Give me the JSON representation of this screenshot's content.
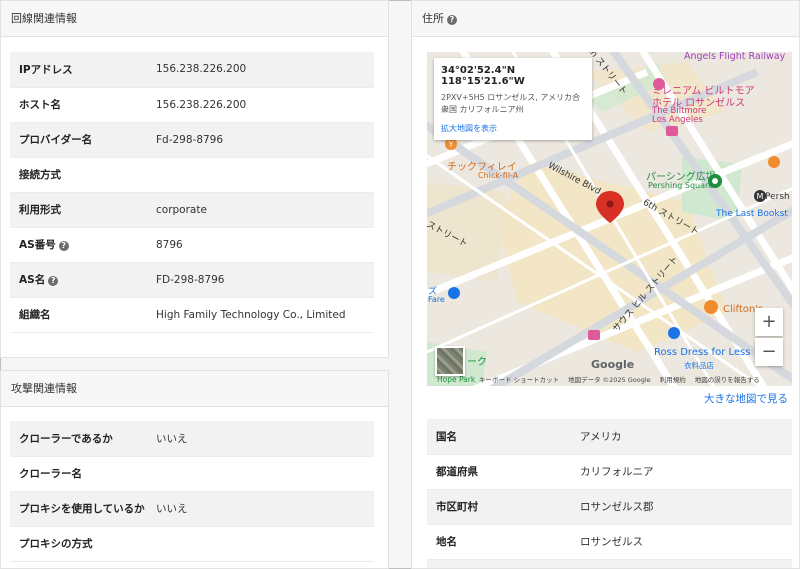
{
  "line_panel": {
    "title": "回線関連情報",
    "rows": [
      {
        "label": "IPアドレス",
        "value": "156.238.226.200",
        "help": false
      },
      {
        "label": "ホスト名",
        "value": "156.238.226.200",
        "help": false
      },
      {
        "label": "プロバイダー名",
        "value": "Fd-298-8796",
        "help": false
      },
      {
        "label": "接続方式",
        "value": "",
        "help": false
      },
      {
        "label": "利用形式",
        "value": "corporate",
        "help": false
      },
      {
        "label": "AS番号",
        "value": "8796",
        "help": true
      },
      {
        "label": "AS名",
        "value": "FD-298-8796",
        "help": true
      },
      {
        "label": "組織名",
        "value": "High Family Technology Co., Limited",
        "help": false
      }
    ]
  },
  "attack_panel": {
    "title": "攻撃関連情報",
    "rows": [
      {
        "label": "クローラーであるか",
        "value": "いいえ"
      },
      {
        "label": "クローラー名",
        "value": ""
      },
      {
        "label": "プロキシを使用しているか",
        "value": "いいえ"
      },
      {
        "label": "プロキシの方式",
        "value": ""
      }
    ]
  },
  "address_panel": {
    "title": "住所",
    "map": {
      "coords": "34°02'52.4\"N 118°15'21.6\"W",
      "address_line1": "2PXV+5H5 ロサンゼルス, アメリカ合",
      "address_line2": "衆国 カリフォルニア州",
      "larger_map_link": "拡大地図を表示",
      "zoom_in": "+",
      "zoom_out": "−",
      "google_logo": "Google",
      "attribution": [
        "キーボード ショートカット",
        "地図データ ©2025 Google",
        "利用規約",
        "地図の誤りを報告する"
      ],
      "labels": {
        "angels_flight": "Angels Flight Railway",
        "millennium_1": "ミレニアム ビルトモア",
        "millennium_2": "ホテル ロサンゼルス",
        "biltmore_1": "The Biltmore",
        "biltmore_2": "Los Angeles",
        "chickfila_ja": "チックフィレイ",
        "chickfila_en": "Chick-fil-A",
        "wilshire": "Wilshire Blvd",
        "pershing_ja": "パーシング広場",
        "pershing_en": "Pershing Square",
        "pershing_station": "Persh",
        "last_bookstore": "The Last Bookst",
        "sixth_street": "6th ストリート",
        "fifth_street": "5th ストリート",
        "hill_street": "サウス ヒル ストリート",
        "cliftons": "Clifton's",
        "ross_en": "Ross Dress for Less",
        "ross_ja": "衣料品店",
        "hope_park": "Hope Park",
        "street_left": "ストリート",
        "park_fragment": "ーク",
        "fare_1": "ズ",
        "fare_2": "Fare"
      }
    },
    "larger_map": "大きな地図で見る",
    "rows": [
      {
        "label": "国名",
        "value": "アメリカ"
      },
      {
        "label": "都道府県",
        "value": "カリフォルニア"
      },
      {
        "label": "市区町村",
        "value": "ロサンゼルス郡"
      },
      {
        "label": "地名",
        "value": "ロサンゼルス"
      },
      {
        "label": "",
        "value": ""
      }
    ]
  },
  "colors": {
    "link": "#1a73e8",
    "pin": "#d93025",
    "park": "#c9e9c9",
    "road": "#ffffff",
    "block": "#f2e4c4"
  }
}
